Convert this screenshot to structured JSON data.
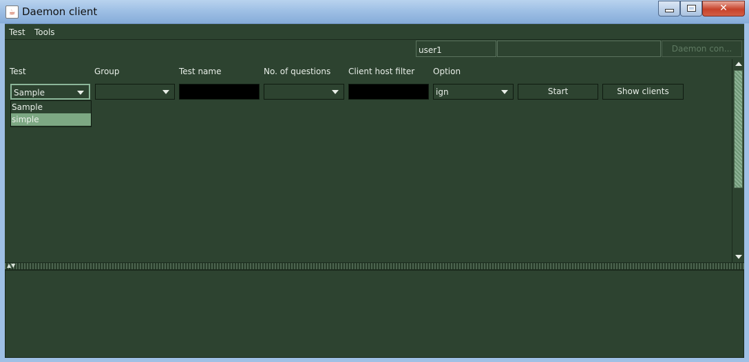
{
  "window": {
    "title": "Daemon client"
  },
  "menu": {
    "items": [
      "Test",
      "Tools"
    ]
  },
  "top": {
    "user": "user1",
    "daemon_button": "Daemon con..."
  },
  "form": {
    "labels": [
      "Test",
      "Group",
      "Test name",
      "No. of questions",
      "Client host filter",
      "Option"
    ],
    "test_value": "Sample",
    "group_value": "",
    "test_name_value": "",
    "questions_value": "",
    "client_filter_value": "",
    "option_value": "ign",
    "start_label": "Start",
    "show_clients_label": "Show clients"
  },
  "dropdown": {
    "options": [
      "Sample",
      "simple"
    ],
    "highlighted": "simple"
  },
  "colors": {
    "panel": "#2d4330",
    "highlight": "#7da883",
    "text": "#e8eee8"
  }
}
